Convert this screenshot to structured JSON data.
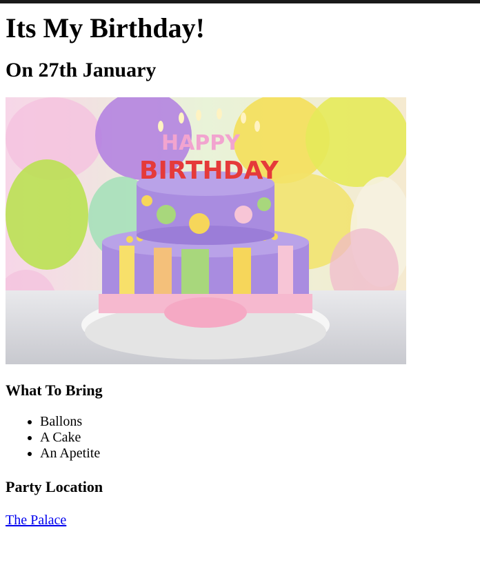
{
  "page": {
    "title": "Its My Birthday!",
    "date_heading": "On 27th January",
    "image_alt": "Birthday cake",
    "bring_heading": "What To Bring",
    "bring_items": [
      "Ballons",
      "A Cake",
      "An Apetite"
    ],
    "location_heading": "Party Location",
    "location_link": "The Palace"
  },
  "cake_text": {
    "line1": "HAPPY",
    "line2": "BIRTHDAY"
  }
}
